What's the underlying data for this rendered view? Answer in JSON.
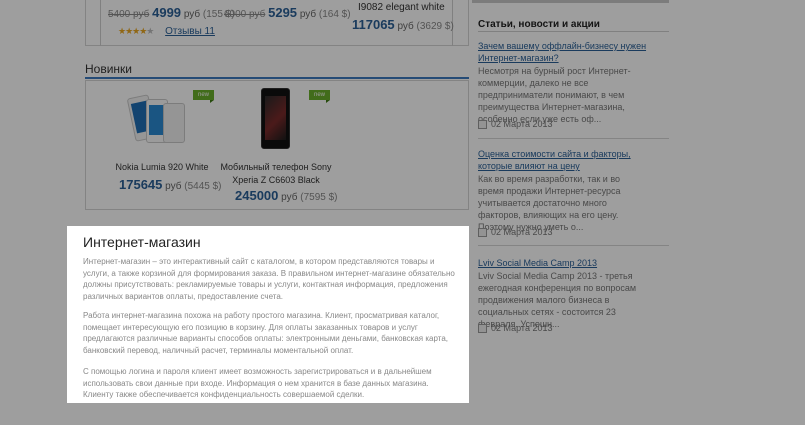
{
  "top_products": {
    "item1": {
      "old_price": "5400 руб",
      "price": "4999",
      "currency": "руб",
      "usd": "(155 $)"
    },
    "item2": {
      "old_price": "6000 руб",
      "price": "5295",
      "currency": "руб",
      "usd": "(164 $)"
    },
    "item3": {
      "name": "I9082 elegant white",
      "price": "117065",
      "currency": "руб",
      "usd": "(3629 $)"
    },
    "rating": {
      "stars": 4,
      "max": 5,
      "reviews_label": "Отзывы 11"
    }
  },
  "novinki": {
    "title": "Новинки",
    "badge": "new",
    "products": [
      {
        "name": "Nokia Lumia 920 White",
        "price": "175645",
        "currency": "руб",
        "usd": "(5445 $)"
      },
      {
        "name": "Мобильный телефон Sony Xperia Z C6603 Black",
        "price": "245000",
        "currency": "руб",
        "usd": "(7595 $)"
      }
    ]
  },
  "sidebar": {
    "title": "Статьи, новости и акции",
    "news": [
      {
        "link": "Зачем вашему оффлайн-бизнесу нужен Интернет-магазин?",
        "text": "Несмотря на бурный рост Интернет-коммерции, далеко не все предприниматели понимают, в чем преимущества Интернет-магазина, особенно если уже есть оф...",
        "date": "02 Марта 2013"
      },
      {
        "link": "Оценка стоимости сайта и факторы, которые влияют на цену",
        "text": "Как во время разработки, так и во время продажи Интернет-ресурса учитывается достаточно много факторов, влияющих на его цену. Поэтому нужно уметь о...",
        "date": "02 Марта 2013"
      },
      {
        "link": "Lviv Social Media Camp 2013",
        "text": "Lviv Social Media Camp 2013 - третья ежегодная конференция по вопросам продвижения малого бизнеса в социальных сетях - состоится 23 февраля. Успешн...",
        "date": "02 Марта 2013"
      }
    ]
  },
  "popup": {
    "title": "Интернет-магазин",
    "paragraphs": [
      "Интернет-магазин – это интерактивный сайт с каталогом, в котором представляются товары и услуги, а также корзиной для формирования заказа. В правильном интернет-магазине обязательно должны присутствовать: рекламируемые товары и услуги, контактная информация, предложения различных вариантов оплаты, предоставление счета.",
      "Работа интернет-магазина похожа на работу простого магазина. Клиент, просматривая каталог, помещает интересующую его позицию в корзину. Для оплаты заказанных товаров и услуг предлагаются различные варианты способов оплаты: электронными деньгами, банковская карта, банковский перевод, наличный расчет, терминалы моментальной оплат.",
      "С помощью логина и пароля клиент имеет возможность зарегистрироваться и в дальнейшем использовать свои данные при входе. Информация о нем хранится в базе данных магазина. Клиенту также обеспечивается конфиденциальность совершаемой сделки."
    ]
  },
  "colors": {
    "accent": "#2a5f96",
    "badge": "#6aaf2a",
    "overlay": "rgba(0,0,0,0.38)"
  }
}
